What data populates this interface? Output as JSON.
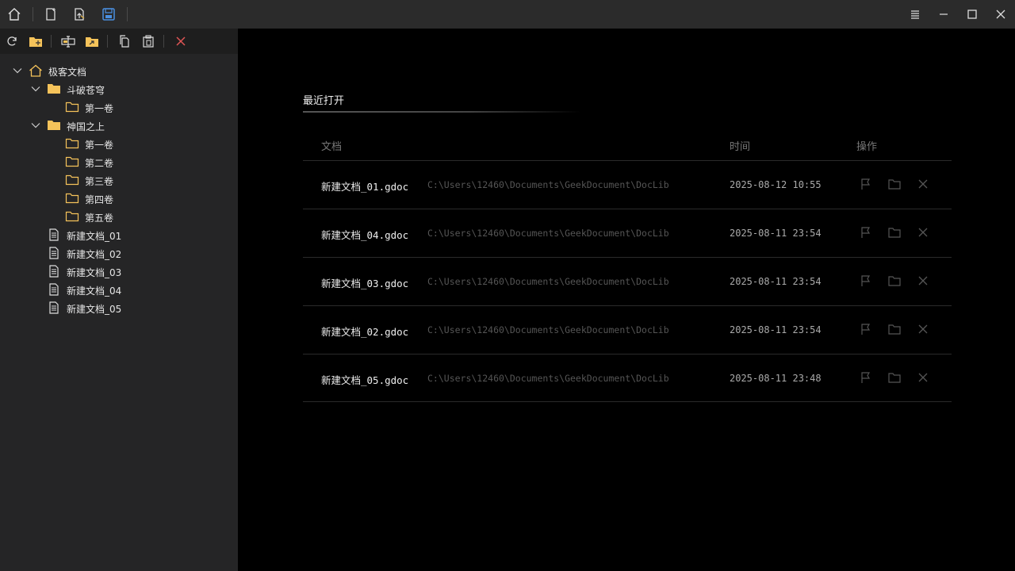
{
  "titlebar": {
    "left_icons": [
      "home-icon",
      "new-document-icon",
      "export-document-icon",
      "save-icon"
    ],
    "right_icons": [
      "menu-icon",
      "minimize-icon",
      "maximize-icon",
      "close-icon"
    ]
  },
  "sidebar": {
    "toolbar_icons": [
      "refresh-icon",
      "new-folder-icon",
      "rename-icon",
      "move-folder-icon",
      "copy-icon",
      "paste-icon",
      "delete-icon"
    ],
    "tree": {
      "root": "极客文档",
      "folders": [
        {
          "label": "斗破苍穹",
          "children": [
            "第一卷"
          ]
        },
        {
          "label": "神国之上",
          "children": [
            "第一卷",
            "第二卷",
            "第三卷",
            "第四卷",
            "第五卷"
          ]
        }
      ],
      "documents": [
        "新建文档_01",
        "新建文档_02",
        "新建文档_03",
        "新建文档_04",
        "新建文档_05"
      ]
    }
  },
  "main": {
    "section_title": "最近打开",
    "columns": {
      "doc": "文档",
      "time": "时间",
      "action": "操作"
    },
    "recent": [
      {
        "name": "新建文档_01.gdoc",
        "path": "C:\\Users\\12460\\Documents\\GeekDocument\\DocLib",
        "time": "2025-08-12 10:55"
      },
      {
        "name": "新建文档_04.gdoc",
        "path": "C:\\Users\\12460\\Documents\\GeekDocument\\DocLib",
        "time": "2025-08-11 23:54"
      },
      {
        "name": "新建文档_03.gdoc",
        "path": "C:\\Users\\12460\\Documents\\GeekDocument\\DocLib",
        "time": "2025-08-11 23:54"
      },
      {
        "name": "新建文档_02.gdoc",
        "path": "C:\\Users\\12460\\Documents\\GeekDocument\\DocLib",
        "time": "2025-08-11 23:54"
      },
      {
        "name": "新建文档_05.gdoc",
        "path": "C:\\Users\\12460\\Documents\\GeekDocument\\DocLib",
        "time": "2025-08-11 23:48"
      }
    ],
    "row_action_icons": [
      "flag-icon",
      "open-folder-icon",
      "remove-icon"
    ]
  },
  "colors": {
    "folder": "#f5c35a",
    "accent_save": "#3a7bd5",
    "delete": "#e05555"
  }
}
